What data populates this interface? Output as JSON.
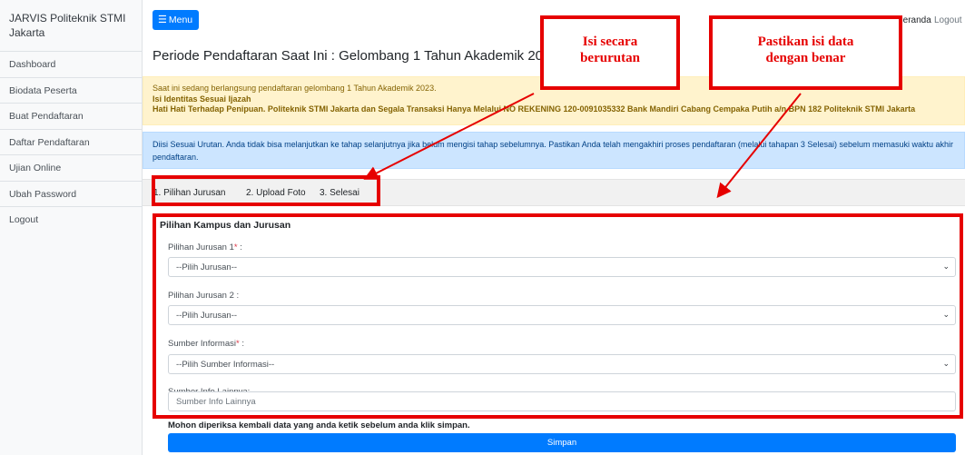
{
  "sidebar": {
    "brand": "JARVIS Politeknik STMI Jakarta",
    "items": [
      {
        "label": "Dashboard"
      },
      {
        "label": "Biodata Peserta"
      },
      {
        "label": "Buat Pendaftaran"
      },
      {
        "label": "Daftar Pendaftaran"
      },
      {
        "label": "Ujian Online"
      },
      {
        "label": "Ubah Password"
      },
      {
        "label": "Logout"
      }
    ]
  },
  "topbar": {
    "menu_label": "Menu",
    "menu_icon": "hamburger-icon",
    "nav": [
      {
        "label": "Beranda"
      },
      {
        "label": "Logout"
      }
    ]
  },
  "page": {
    "title": "Periode Pendaftaran Saat Ini : Gelombang 1 Tahun Akademik 2023"
  },
  "alerts": {
    "warning": {
      "line1": "Saat ini sedang berlangsung pendaftaran gelombang 1 Tahun Akademik 2023.",
      "line2": "Isi Identitas Sesuai Ijazah",
      "line3": "Hati Hati Terhadap Penipuan. Politeknik STMI Jakarta dan Segala Transaksi Hanya Melalui NO REKENING 120-0091035332 Bank Mandiri Cabang Cempaka Putih a/n BPN 182 Politeknik STMI Jakarta"
    },
    "info": "Diisi Sesuai Urutan. Anda tidak bisa melanjutkan ke tahap selanjutnya jika belum mengisi tahap sebelumnya. Pastikan Anda telah mengakhiri proses pendaftaran (melalui tahapan 3 Selesai) sebelum memasuki waktu akhir pendaftaran."
  },
  "steps": [
    {
      "label": "1. Pilihan Jurusan"
    },
    {
      "label": "2. Upload Foto"
    },
    {
      "label": "3. Selesai"
    }
  ],
  "form": {
    "legend": "Pilihan Kampus dan Jurusan",
    "jurusan1": {
      "label": "Pilihan Jurusan 1",
      "required_mark": "*",
      "colon": " :",
      "value": "--Pilih Jurusan--"
    },
    "jurusan2": {
      "label": "Pilihan Jurusan 2 :",
      "value": "--Pilih Jurusan--"
    },
    "sumber": {
      "label": "Sumber Informasi",
      "required_mark": "*",
      "colon": " :",
      "value": "--Pilih Sumber Informasi--"
    },
    "lainnya": {
      "label": "Sumber Info Lainnya:",
      "placeholder": "Sumber Info Lainnya"
    },
    "confirm_text": "Mohon diperiksa kembali data yang anda ketik sebelum anda klik simpan.",
    "save_label": "Simpan"
  },
  "annotations": {
    "callout1": {
      "line1": "Isi secara",
      "line2": "berurutan"
    },
    "callout2": {
      "line1": "Pastikan isi data",
      "line2": "dengan benar"
    },
    "color": "#e60000"
  },
  "colors": {
    "primary": "#007bff",
    "warning_bg": "#fff3cd",
    "info_bg": "#cce5ff"
  }
}
